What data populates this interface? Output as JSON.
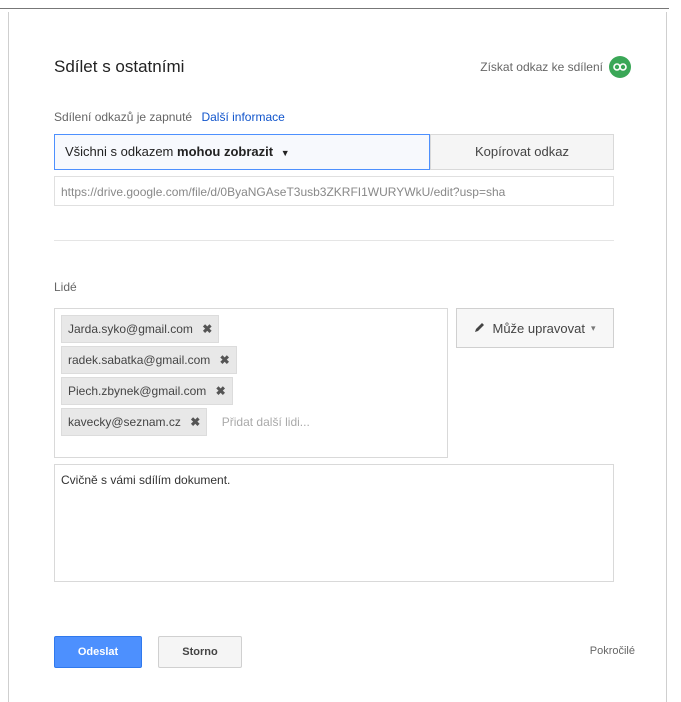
{
  "dialog": {
    "title": "Sdílet s ostatními",
    "get_link_label": "Získat odkaz ke sdílení"
  },
  "link_sharing": {
    "status": "Sdílení odkazů je zapnuté",
    "more_info": "Další informace",
    "access_prefix": "Všichni s odkazem",
    "access_level": "mohou zobrazit",
    "copy_label": "Kopírovat odkaz",
    "url": "https://drive.google.com/file/d/0ByaNGAseT3usb3ZKRFI1WURYWkU/edit?usp=sha"
  },
  "people": {
    "label": "Lidé",
    "chips": [
      "Jarda.syko@gmail.com",
      "radek.sabatka@gmail.com",
      "Piech.zbynek@gmail.com",
      "kavecky@seznam.cz"
    ],
    "add_placeholder": "Přidat další lidi...",
    "permission": "Může upravovat"
  },
  "message": {
    "text": "Cvičně s vámi sdílím dokument."
  },
  "footer": {
    "send_label": "Odeslat",
    "cancel_label": "Storno",
    "advanced_label": "Pokročilé"
  },
  "colors": {
    "accent_blue": "#4d90fe",
    "link_green": "#3aa757"
  }
}
